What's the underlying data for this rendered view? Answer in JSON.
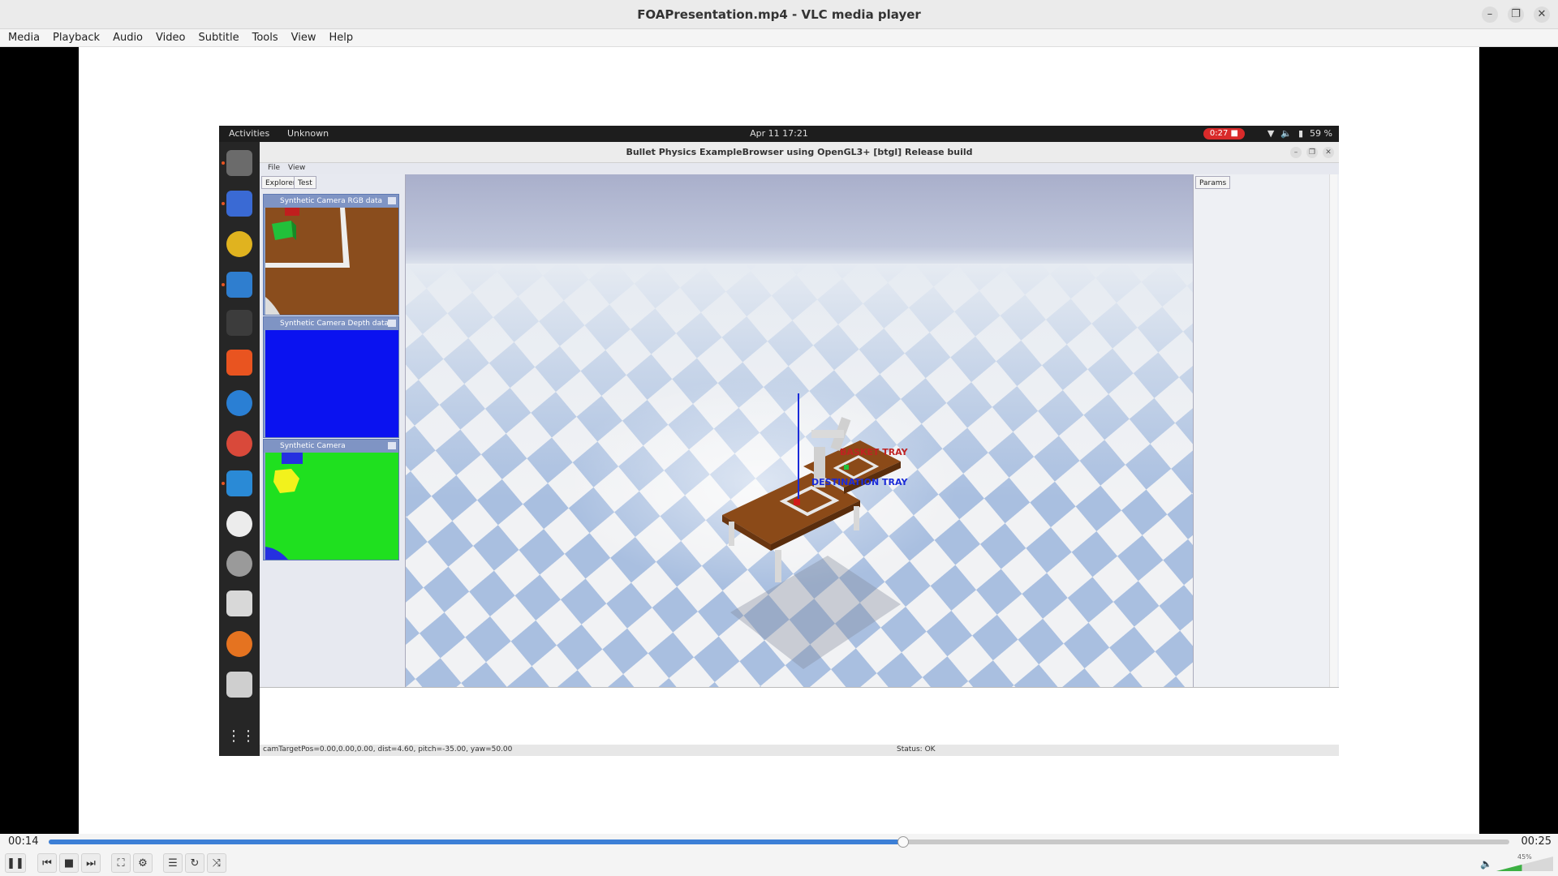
{
  "window": {
    "title": "FOAPresentation.mp4 - VLC media player"
  },
  "menu": [
    "Media",
    "Playback",
    "Audio",
    "Video",
    "Subtitle",
    "Tools",
    "View",
    "Help"
  ],
  "ubuntu": {
    "activities": "Activities",
    "app": "Unknown",
    "clock": "Apr 11  17:21",
    "recording": "0:27",
    "battery": "59 %"
  },
  "bullet": {
    "title": "Bullet Physics ExampleBrowser using OpenGL3+ [btgl] Release build",
    "menu": [
      "File",
      "View"
    ],
    "tabs": [
      "Explorer",
      "Test"
    ],
    "params_tab": "Params",
    "panels": [
      "Synthetic Camera RGB data",
      "Synthetic Camera Depth data",
      "Synthetic Camera Segmentation Mask"
    ],
    "labels": {
      "basket": "BASKET TRAY",
      "destination": "DESTINATION TRAY"
    },
    "status_left": "camTargetPos=0.00,0.00,0.00, dist=4.60, pitch=-35.00, yaw=50.00",
    "status_right": "Status: OK"
  },
  "player": {
    "elapsed": "00:14",
    "total": "00:25",
    "progress_percent": 58.5,
    "volume": "45%",
    "volume_percent": 45
  },
  "colors": {
    "seek": "#3c7fd6",
    "recording": "#d92a2a",
    "ubuntu_accent": "#e95420"
  }
}
